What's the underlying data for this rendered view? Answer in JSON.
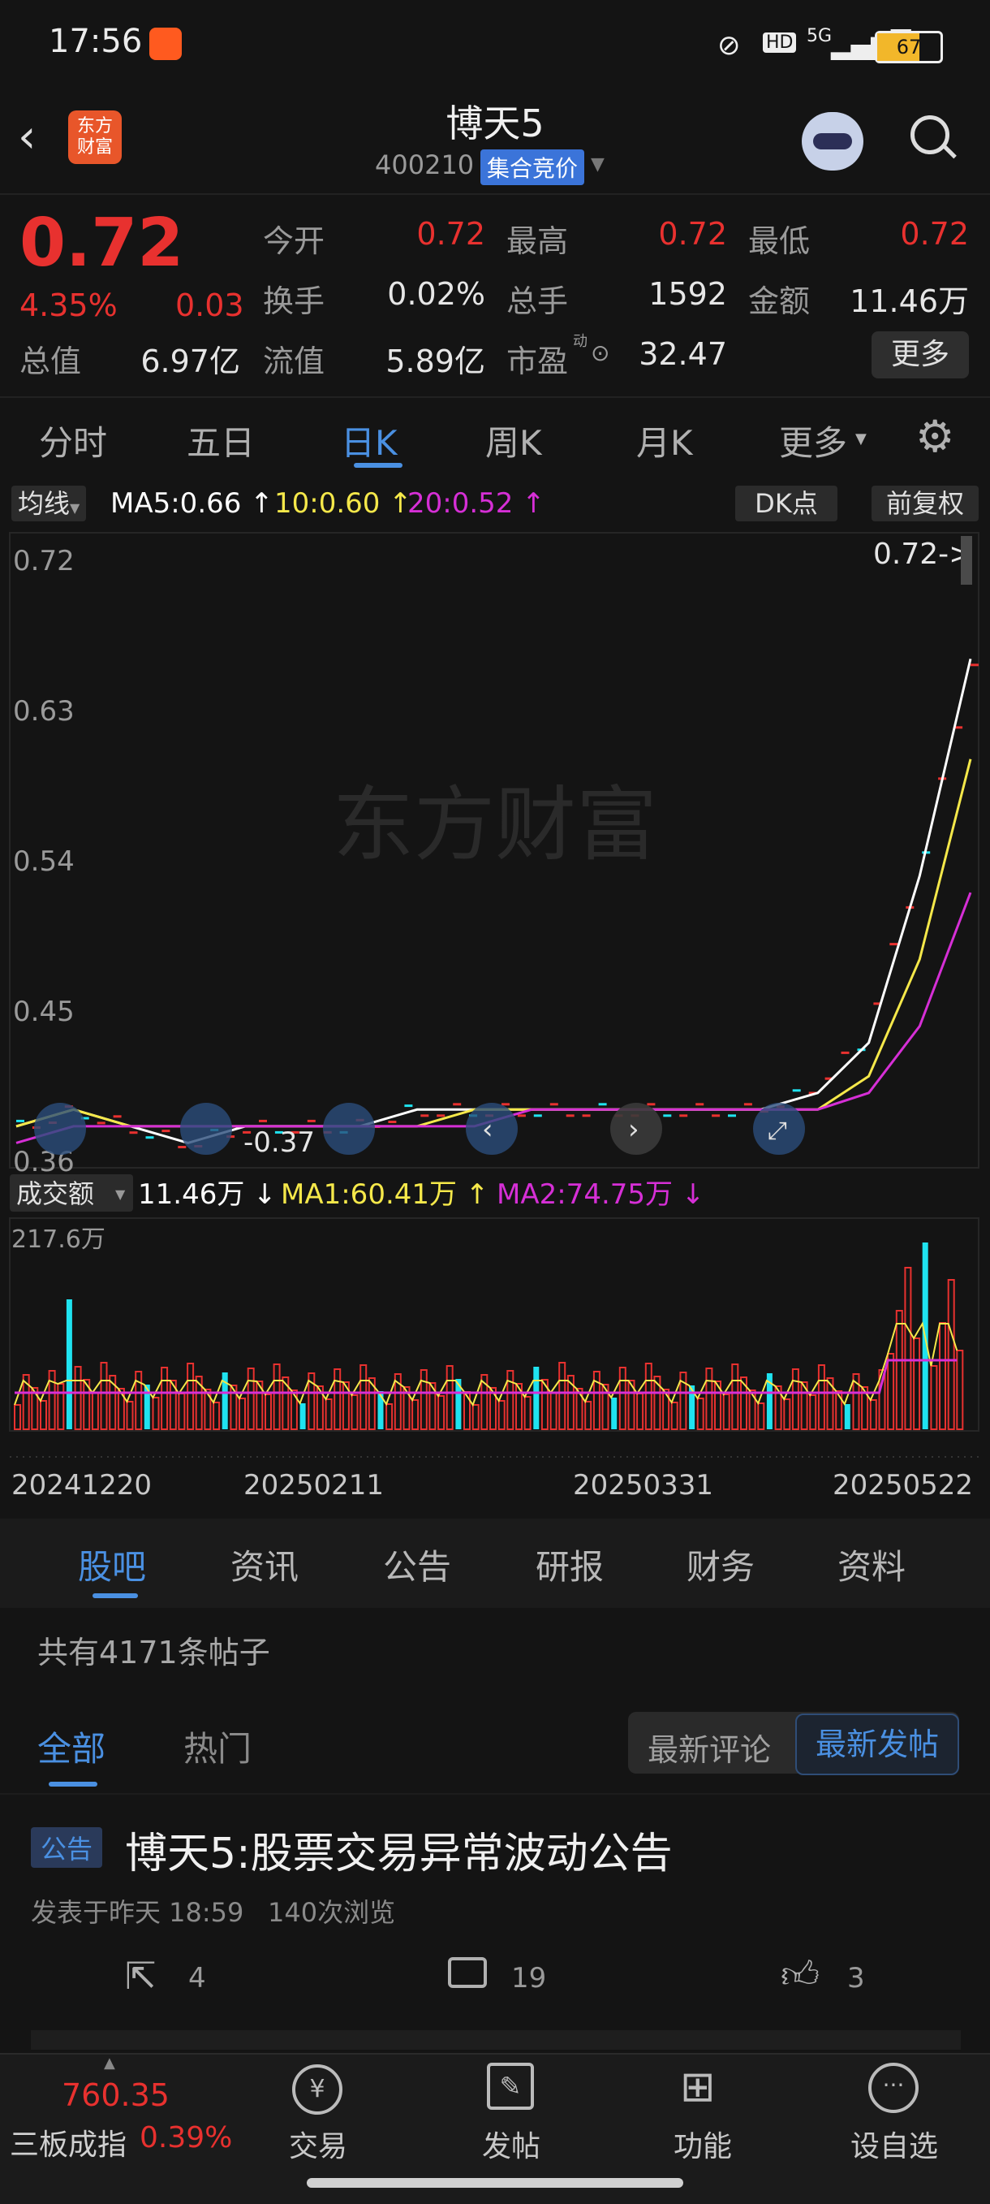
{
  "status_bar": {
    "time": "17:56",
    "network": "5G",
    "hd": "HD",
    "battery": "67"
  },
  "header": {
    "title": "博天5",
    "code": "400210",
    "auction_badge": "集合竞价",
    "logo_text": "东方\n财富"
  },
  "quote": {
    "price": "0.72",
    "change_pct": "4.35%",
    "change": "0.03",
    "open_label": "今开",
    "open": "0.72",
    "high_label": "最高",
    "high": "0.72",
    "low_label": "最低",
    "low": "0.72",
    "turnover_label": "换手",
    "turnover": "0.02%",
    "volume_label": "总手",
    "volume": "1592",
    "amount_label": "金额",
    "amount": "11.46万",
    "mktcap_label": "总值",
    "mktcap": "6.97亿",
    "float_label": "流值",
    "float": "5.89亿",
    "pe_label": "市盈",
    "pe_sup": "动",
    "pe": "32.47",
    "more_button": "更多"
  },
  "tabs": [
    "分时",
    "五日",
    "日K",
    "周K",
    "月K",
    "更多"
  ],
  "active_tab": "日K",
  "ma_bar": {
    "selector": "均线",
    "ma5": "MA5:0.66",
    "ma10": "10:0.60",
    "ma20": "20:0.52",
    "dk": "DK点",
    "adjust": "前复权"
  },
  "kline": {
    "y_ticks": [
      "0.72",
      "0.63",
      "0.54",
      "0.45",
      "0.36"
    ],
    "y_values": [
      0.72,
      0.63,
      0.54,
      0.45,
      0.36
    ],
    "last_price_marker": "0.72->",
    "low_marker": "0.37",
    "watermark": "东方财富"
  },
  "volume_bar": {
    "selector": "成交额",
    "value": "11.46万",
    "ma1": "MA1:60.41万",
    "ma2": "MA2:74.75万",
    "max_label": "217.6万"
  },
  "x_dates": [
    "20241220",
    "20250211",
    "20250331",
    "20250522"
  ],
  "colors": {
    "up": "#e8312f",
    "cyan": "#1fe3f0",
    "ma5": "#ffffff",
    "ma10": "#f5e84a",
    "ma20": "#d62fd6",
    "accent": "#4a90e2"
  },
  "chart_data": {
    "type": "bar",
    "title": "",
    "series": [
      {
        "name": "MA5",
        "values": [
          0.38,
          0.39,
          0.38,
          0.37,
          0.38,
          0.38,
          0.38,
          0.39,
          0.39,
          0.39,
          0.39,
          0.39,
          0.39,
          0.39,
          0.4,
          0.43,
          0.53,
          0.66
        ]
      },
      {
        "name": "MA10",
        "values": [
          0.38,
          0.39,
          0.38,
          0.38,
          0.38,
          0.38,
          0.38,
          0.38,
          0.39,
          0.39,
          0.39,
          0.39,
          0.39,
          0.39,
          0.39,
          0.41,
          0.48,
          0.6
        ]
      },
      {
        "name": "MA20",
        "values": [
          0.37,
          0.38,
          0.38,
          0.38,
          0.38,
          0.38,
          0.38,
          0.38,
          0.38,
          0.39,
          0.39,
          0.39,
          0.39,
          0.39,
          0.39,
          0.4,
          0.44,
          0.52
        ]
      }
    ],
    "ylim": [
      0.36,
      0.72
    ]
  },
  "section_tabs": [
    "股吧",
    "资讯",
    "公告",
    "研报",
    "财务",
    "资料"
  ],
  "active_section": "股吧",
  "post_count": "共有4171条帖子",
  "filter_tabs": [
    "全部",
    "热门"
  ],
  "sort_buttons": [
    "最新评论",
    "最新发帖"
  ],
  "post": {
    "badge": "公告",
    "title": "博天5:股票交易异常波动公告",
    "meta": "发表于昨天 18:59",
    "views": "140次浏览",
    "shares": "4",
    "comments": "19",
    "likes": "3"
  },
  "bottom_nav": {
    "index_value": "760.35",
    "index_name": "三板成指",
    "index_change": "0.39%",
    "items": [
      "交易",
      "发帖",
      "功能",
      "设自选"
    ]
  }
}
